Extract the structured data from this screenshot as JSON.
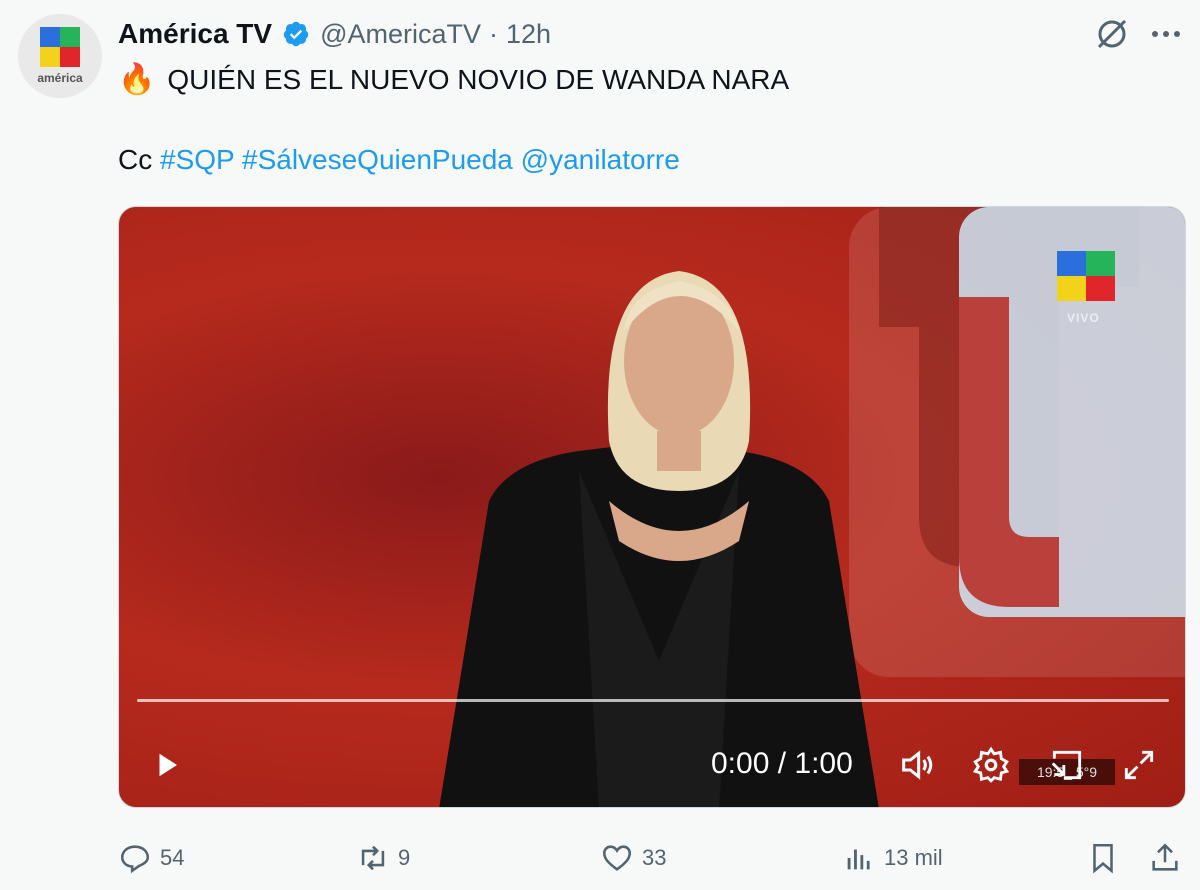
{
  "account": {
    "display_name": "América TV",
    "handle": "@AmericaTV",
    "separator": "·",
    "time": "12h",
    "avatar_text": "américa",
    "verified": true
  },
  "post": {
    "emoji": "🔥",
    "headline": "QUIÉN ES EL NUEVO NOVIO DE WANDA NARA",
    "cc_label": "Cc",
    "hashtags": [
      "#SQP",
      "#SálveseQuienPueda"
    ],
    "mention": "@yanilatorre"
  },
  "video": {
    "overlay_label": "VIVO",
    "current_time": "0:00 / 1:00",
    "progress": 0.0,
    "clock_badge": "19:5_ 5°9"
  },
  "actions": {
    "replies": "54",
    "reposts": "9",
    "likes": "33",
    "views": "13 mil"
  },
  "icons": {
    "grok": "grok-icon",
    "more": "more-icon",
    "play": "play-icon",
    "volume": "volume-icon",
    "settings": "gear-icon",
    "pip": "picture-in-picture-icon",
    "fullscreen": "fullscreen-icon",
    "reply": "reply-icon",
    "repost": "repost-icon",
    "like": "heart-icon",
    "views": "views-icon",
    "bookmark": "bookmark-icon",
    "share": "share-icon"
  },
  "colors": {
    "link": "#1d9bf0",
    "muted": "#536471",
    "text": "#0f1419",
    "verified": "#1d9bf0"
  }
}
